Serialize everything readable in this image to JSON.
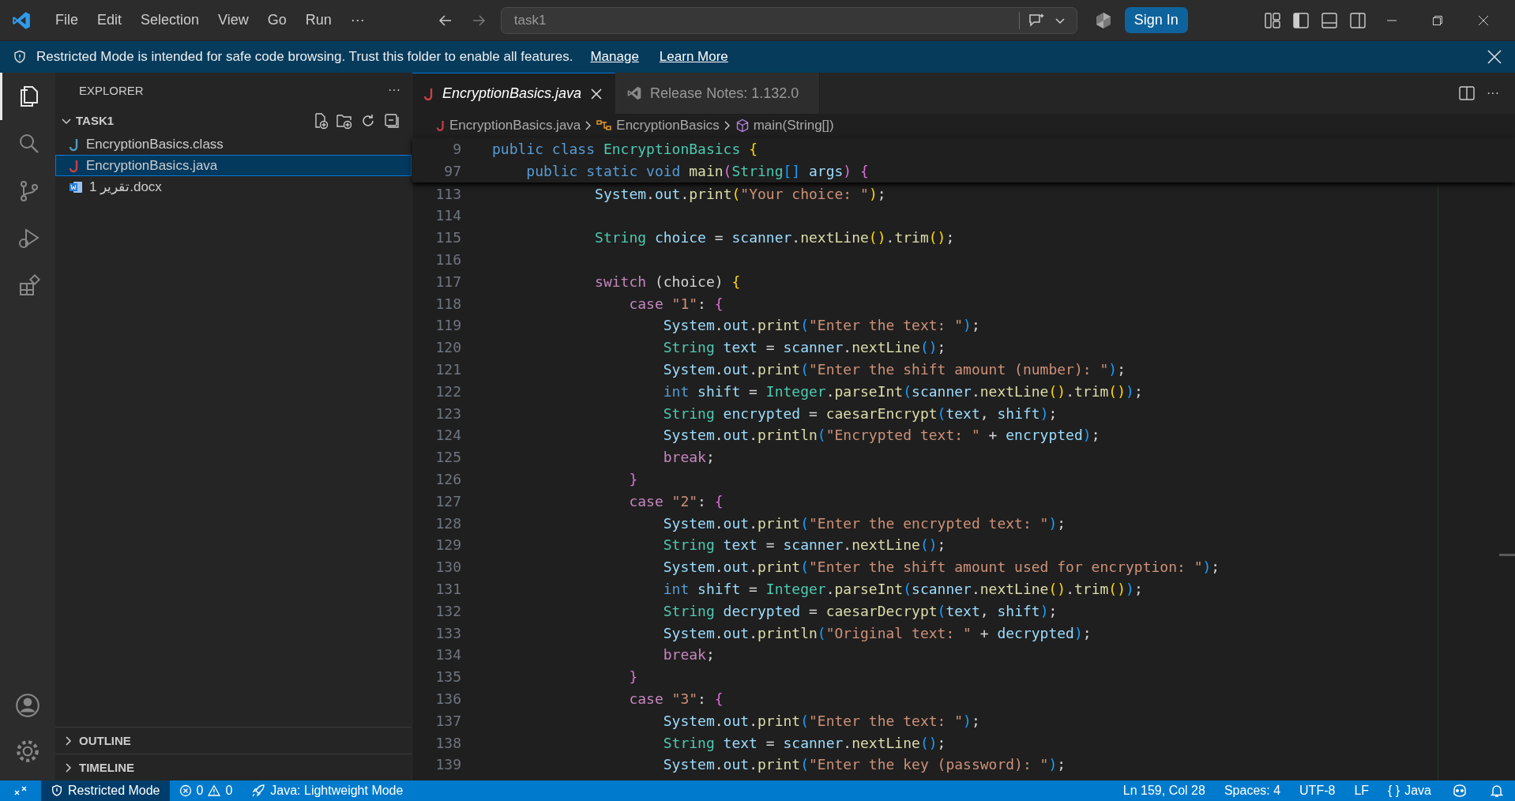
{
  "title_bar": {
    "menus": [
      "File",
      "Edit",
      "Selection",
      "View",
      "Go",
      "Run",
      "···"
    ],
    "command_center": "task1",
    "sign_in": "Sign In"
  },
  "banner": {
    "message": "Restricted Mode is intended for safe code browsing. Trust this folder to enable all features.",
    "links": [
      "Manage",
      "Learn More"
    ]
  },
  "activity_bar": [
    {
      "kind": "explorer",
      "selected": true
    },
    {
      "kind": "search",
      "selected": false
    },
    {
      "kind": "source-control",
      "selected": false
    },
    {
      "kind": "run-debug",
      "selected": false
    },
    {
      "kind": "extensions",
      "selected": false
    }
  ],
  "sidebar": {
    "title": "EXPLORER",
    "more": "···",
    "folder": {
      "label": "TASK1",
      "expanded": true,
      "children": [
        {
          "label": "EncryptionBasics.class",
          "kind": "class",
          "selected": false
        },
        {
          "label": "EncryptionBasics.java",
          "kind": "java",
          "selected": true
        },
        {
          "label": "تقرير 1.docx",
          "kind": "docx",
          "selected": false
        }
      ]
    },
    "sections": [
      {
        "label": "OUTLINE",
        "expanded": false
      },
      {
        "label": "TIMELINE",
        "expanded": false
      }
    ]
  },
  "tabs": [
    {
      "label": "EncryptionBasics.java",
      "kind": "java",
      "selected": true,
      "preview": true
    },
    {
      "label": "Release Notes: 1.132.0",
      "kind": "vscode",
      "selected": false,
      "preview": false
    }
  ],
  "breadcrumb": [
    {
      "label": "EncryptionBasics.java",
      "kind": "file"
    },
    {
      "label": "EncryptionBasics",
      "kind": "class"
    },
    {
      "label": "main(String[])",
      "kind": "method"
    }
  ],
  "sticky_lines": [
    {
      "number": "9",
      "tokens": [
        {
          "kind": "kw",
          "text": "public "
        },
        {
          "kind": "kw",
          "text": "class "
        },
        {
          "kind": "type",
          "text": "EncryptionBasics "
        },
        {
          "kind": "b1",
          "text": "{"
        }
      ]
    },
    {
      "number": "97",
      "tokens": [
        {
          "kind": "kw",
          "text": "    public static void "
        },
        {
          "kind": "fn",
          "text": "main"
        },
        {
          "kind": "b2",
          "text": "("
        },
        {
          "kind": "type",
          "text": "String"
        },
        {
          "kind": "b3",
          "text": "[]"
        },
        {
          "kind": "var",
          "text": " args"
        },
        {
          "kind": "b2",
          "text": ")"
        },
        {
          "kind": "b2",
          "text": " {"
        }
      ]
    }
  ],
  "code_lines": [
    {
      "number": "113",
      "tokens": [
        {
          "kind": "var",
          "text": "            System"
        },
        {
          "kind": "plain",
          "text": "."
        },
        {
          "kind": "var",
          "text": "out"
        },
        {
          "kind": "plain",
          "text": "."
        },
        {
          "kind": "fn",
          "text": "print"
        },
        {
          "kind": "b1",
          "text": "("
        },
        {
          "kind": "str",
          "text": "\"Your choice: \""
        },
        {
          "kind": "b1",
          "text": ")"
        },
        {
          "kind": "plain",
          "text": ";"
        }
      ]
    },
    {
      "number": "114"
    },
    {
      "number": "115",
      "tokens": [
        {
          "kind": "type",
          "text": "            String "
        },
        {
          "kind": "var",
          "text": "choice"
        },
        {
          "kind": "plain",
          "text": " = "
        },
        {
          "kind": "var",
          "text": "scanner"
        },
        {
          "kind": "plain",
          "text": "."
        },
        {
          "kind": "fn",
          "text": "nextLine"
        },
        {
          "kind": "b1",
          "text": "()"
        },
        {
          "kind": "plain",
          "text": "."
        },
        {
          "kind": "fn",
          "text": "trim"
        },
        {
          "kind": "b1",
          "text": "()"
        },
        {
          "kind": "plain",
          "text": ";"
        }
      ]
    },
    {
      "number": "116"
    },
    {
      "number": "117",
      "tokens": [
        {
          "kind": "ctrl",
          "text": "            switch "
        },
        {
          "kind": "plain",
          "text": "(choice) "
        },
        {
          "kind": "b1",
          "text": "{"
        }
      ]
    },
    {
      "number": "118",
      "tokens": [
        {
          "kind": "ctrl",
          "text": "                case "
        },
        {
          "kind": "str",
          "text": "\"1\""
        },
        {
          "kind": "plain",
          "text": ": "
        },
        {
          "kind": "b2",
          "text": "{"
        }
      ]
    },
    {
      "number": "119",
      "tokens": [
        {
          "kind": "var",
          "text": "                    System"
        },
        {
          "kind": "plain",
          "text": "."
        },
        {
          "kind": "var",
          "text": "out"
        },
        {
          "kind": "plain",
          "text": "."
        },
        {
          "kind": "fn",
          "text": "print"
        },
        {
          "kind": "b3",
          "text": "("
        },
        {
          "kind": "str",
          "text": "\"Enter the text: \""
        },
        {
          "kind": "b3",
          "text": ")"
        },
        {
          "kind": "plain",
          "text": ";"
        }
      ]
    },
    {
      "number": "120",
      "tokens": [
        {
          "kind": "type",
          "text": "                    String "
        },
        {
          "kind": "var",
          "text": "text"
        },
        {
          "kind": "plain",
          "text": " = "
        },
        {
          "kind": "var",
          "text": "scanner"
        },
        {
          "kind": "plain",
          "text": "."
        },
        {
          "kind": "fn",
          "text": "nextLine"
        },
        {
          "kind": "b3",
          "text": "()"
        },
        {
          "kind": "plain",
          "text": ";"
        }
      ]
    },
    {
      "number": "121",
      "tokens": [
        {
          "kind": "var",
          "text": "                    System"
        },
        {
          "kind": "plain",
          "text": "."
        },
        {
          "kind": "var",
          "text": "out"
        },
        {
          "kind": "plain",
          "text": "."
        },
        {
          "kind": "fn",
          "text": "print"
        },
        {
          "kind": "b3",
          "text": "("
        },
        {
          "kind": "str",
          "text": "\"Enter the shift amount (number): \""
        },
        {
          "kind": "b3",
          "text": ")"
        },
        {
          "kind": "plain",
          "text": ";"
        }
      ]
    },
    {
      "number": "122",
      "tokens": [
        {
          "kind": "kw",
          "text": "                    int "
        },
        {
          "kind": "var",
          "text": "shift"
        },
        {
          "kind": "plain",
          "text": " = "
        },
        {
          "kind": "type",
          "text": "Integer"
        },
        {
          "kind": "plain",
          "text": "."
        },
        {
          "kind": "fn",
          "text": "parseInt"
        },
        {
          "kind": "b3",
          "text": "("
        },
        {
          "kind": "var",
          "text": "scanner"
        },
        {
          "kind": "plain",
          "text": "."
        },
        {
          "kind": "fn",
          "text": "nextLine"
        },
        {
          "kind": "b1",
          "text": "()"
        },
        {
          "kind": "plain",
          "text": "."
        },
        {
          "kind": "fn",
          "text": "trim"
        },
        {
          "kind": "b1",
          "text": "()"
        },
        {
          "kind": "b3",
          "text": ")"
        },
        {
          "kind": "plain",
          "text": ";"
        }
      ]
    },
    {
      "number": "123",
      "tokens": [
        {
          "kind": "type",
          "text": "                    String "
        },
        {
          "kind": "var",
          "text": "encrypted"
        },
        {
          "kind": "plain",
          "text": " = "
        },
        {
          "kind": "fn",
          "text": "caesarEncrypt"
        },
        {
          "kind": "b3",
          "text": "("
        },
        {
          "kind": "var",
          "text": "text"
        },
        {
          "kind": "plain",
          "text": ", "
        },
        {
          "kind": "var",
          "text": "shift"
        },
        {
          "kind": "b3",
          "text": ")"
        },
        {
          "kind": "plain",
          "text": ";"
        }
      ]
    },
    {
      "number": "124",
      "tokens": [
        {
          "kind": "var",
          "text": "                    System"
        },
        {
          "kind": "plain",
          "text": "."
        },
        {
          "kind": "var",
          "text": "out"
        },
        {
          "kind": "plain",
          "text": "."
        },
        {
          "kind": "fn",
          "text": "println"
        },
        {
          "kind": "b3",
          "text": "("
        },
        {
          "kind": "str",
          "text": "\"Encrypted text: \""
        },
        {
          "kind": "plain",
          "text": " + "
        },
        {
          "kind": "var",
          "text": "encrypted"
        },
        {
          "kind": "b3",
          "text": ")"
        },
        {
          "kind": "plain",
          "text": ";"
        }
      ]
    },
    {
      "number": "125",
      "tokens": [
        {
          "kind": "ctrl",
          "text": "                    break"
        },
        {
          "kind": "plain",
          "text": ";"
        }
      ]
    },
    {
      "number": "126",
      "tokens": [
        {
          "kind": "b2",
          "text": "                }"
        }
      ]
    },
    {
      "number": "127",
      "tokens": [
        {
          "kind": "ctrl",
          "text": "                case "
        },
        {
          "kind": "str",
          "text": "\"2\""
        },
        {
          "kind": "plain",
          "text": ": "
        },
        {
          "kind": "b2",
          "text": "{"
        }
      ]
    },
    {
      "number": "128",
      "tokens": [
        {
          "kind": "var",
          "text": "                    System"
        },
        {
          "kind": "plain",
          "text": "."
        },
        {
          "kind": "var",
          "text": "out"
        },
        {
          "kind": "plain",
          "text": "."
        },
        {
          "kind": "fn",
          "text": "print"
        },
        {
          "kind": "b3",
          "text": "("
        },
        {
          "kind": "str",
          "text": "\"Enter the encrypted text: \""
        },
        {
          "kind": "b3",
          "text": ")"
        },
        {
          "kind": "plain",
          "text": ";"
        }
      ]
    },
    {
      "number": "129",
      "tokens": [
        {
          "kind": "type",
          "text": "                    String "
        },
        {
          "kind": "var",
          "text": "text"
        },
        {
          "kind": "plain",
          "text": " = "
        },
        {
          "kind": "var",
          "text": "scanner"
        },
        {
          "kind": "plain",
          "text": "."
        },
        {
          "kind": "fn",
          "text": "nextLine"
        },
        {
          "kind": "b3",
          "text": "()"
        },
        {
          "kind": "plain",
          "text": ";"
        }
      ]
    },
    {
      "number": "130",
      "tokens": [
        {
          "kind": "var",
          "text": "                    System"
        },
        {
          "kind": "plain",
          "text": "."
        },
        {
          "kind": "var",
          "text": "out"
        },
        {
          "kind": "plain",
          "text": "."
        },
        {
          "kind": "fn",
          "text": "print"
        },
        {
          "kind": "b3",
          "text": "("
        },
        {
          "kind": "str",
          "text": "\"Enter the shift amount used for encryption: \""
        },
        {
          "kind": "b3",
          "text": ")"
        },
        {
          "kind": "plain",
          "text": ";"
        }
      ]
    },
    {
      "number": "131",
      "tokens": [
        {
          "kind": "kw",
          "text": "                    int "
        },
        {
          "kind": "var",
          "text": "shift"
        },
        {
          "kind": "plain",
          "text": " = "
        },
        {
          "kind": "type",
          "text": "Integer"
        },
        {
          "kind": "plain",
          "text": "."
        },
        {
          "kind": "fn",
          "text": "parseInt"
        },
        {
          "kind": "b3",
          "text": "("
        },
        {
          "kind": "var",
          "text": "scanner"
        },
        {
          "kind": "plain",
          "text": "."
        },
        {
          "kind": "fn",
          "text": "nextLine"
        },
        {
          "kind": "b1",
          "text": "()"
        },
        {
          "kind": "plain",
          "text": "."
        },
        {
          "kind": "fn",
          "text": "trim"
        },
        {
          "kind": "b1",
          "text": "()"
        },
        {
          "kind": "b3",
          "text": ")"
        },
        {
          "kind": "plain",
          "text": ";"
        }
      ]
    },
    {
      "number": "132",
      "tokens": [
        {
          "kind": "type",
          "text": "                    String "
        },
        {
          "kind": "var",
          "text": "decrypted"
        },
        {
          "kind": "plain",
          "text": " = "
        },
        {
          "kind": "fn",
          "text": "caesarDecrypt"
        },
        {
          "kind": "b3",
          "text": "("
        },
        {
          "kind": "var",
          "text": "text"
        },
        {
          "kind": "plain",
          "text": ", "
        },
        {
          "kind": "var",
          "text": "shift"
        },
        {
          "kind": "b3",
          "text": ")"
        },
        {
          "kind": "plain",
          "text": ";"
        }
      ]
    },
    {
      "number": "133",
      "tokens": [
        {
          "kind": "var",
          "text": "                    System"
        },
        {
          "kind": "plain",
          "text": "."
        },
        {
          "kind": "var",
          "text": "out"
        },
        {
          "kind": "plain",
          "text": "."
        },
        {
          "kind": "fn",
          "text": "println"
        },
        {
          "kind": "b3",
          "text": "("
        },
        {
          "kind": "str",
          "text": "\"Original text: \""
        },
        {
          "kind": "plain",
          "text": " + "
        },
        {
          "kind": "var",
          "text": "decrypted"
        },
        {
          "kind": "b3",
          "text": ")"
        },
        {
          "kind": "plain",
          "text": ";"
        }
      ]
    },
    {
      "number": "134",
      "tokens": [
        {
          "kind": "ctrl",
          "text": "                    break"
        },
        {
          "kind": "plain",
          "text": ";"
        }
      ]
    },
    {
      "number": "135",
      "tokens": [
        {
          "kind": "b2",
          "text": "                }"
        }
      ]
    },
    {
      "number": "136",
      "tokens": [
        {
          "kind": "ctrl",
          "text": "                case "
        },
        {
          "kind": "str",
          "text": "\"3\""
        },
        {
          "kind": "plain",
          "text": ": "
        },
        {
          "kind": "b2",
          "text": "{"
        }
      ]
    },
    {
      "number": "137",
      "tokens": [
        {
          "kind": "var",
          "text": "                    System"
        },
        {
          "kind": "plain",
          "text": "."
        },
        {
          "kind": "var",
          "text": "out"
        },
        {
          "kind": "plain",
          "text": "."
        },
        {
          "kind": "fn",
          "text": "print"
        },
        {
          "kind": "b3",
          "text": "("
        },
        {
          "kind": "str",
          "text": "\"Enter the text: \""
        },
        {
          "kind": "b3",
          "text": ")"
        },
        {
          "kind": "plain",
          "text": ";"
        }
      ]
    },
    {
      "number": "138",
      "tokens": [
        {
          "kind": "type",
          "text": "                    String "
        },
        {
          "kind": "var",
          "text": "text"
        },
        {
          "kind": "plain",
          "text": " = "
        },
        {
          "kind": "var",
          "text": "scanner"
        },
        {
          "kind": "plain",
          "text": "."
        },
        {
          "kind": "fn",
          "text": "nextLine"
        },
        {
          "kind": "b3",
          "text": "()"
        },
        {
          "kind": "plain",
          "text": ";"
        }
      ]
    },
    {
      "number": "139",
      "tokens": [
        {
          "kind": "var",
          "text": "                    System"
        },
        {
          "kind": "plain",
          "text": "."
        },
        {
          "kind": "var",
          "text": "out"
        },
        {
          "kind": "plain",
          "text": "."
        },
        {
          "kind": "fn",
          "text": "print"
        },
        {
          "kind": "b3",
          "text": "("
        },
        {
          "kind": "str",
          "text": "\"Enter the key (password): \""
        },
        {
          "kind": "b3",
          "text": ")"
        },
        {
          "kind": "plain",
          "text": ";"
        }
      ]
    }
  ],
  "status_bar": {
    "left": [
      {
        "kind": "remote"
      },
      {
        "kind": "restricted",
        "text": "Restricted Mode"
      },
      {
        "kind": "problems",
        "errors": "0",
        "warnings": "0"
      },
      {
        "kind": "java",
        "text": "Java: Lightweight Mode"
      }
    ],
    "right": [
      {
        "kind": "text",
        "text": "Ln 159, Col 28"
      },
      {
        "kind": "text",
        "text": "Spaces: 4"
      },
      {
        "kind": "text",
        "text": "UTF-8"
      },
      {
        "kind": "text",
        "text": "LF"
      },
      {
        "kind": "language",
        "glyph": "{ }",
        "text": "Java"
      },
      {
        "kind": "copilot"
      },
      {
        "kind": "bell"
      }
    ]
  }
}
